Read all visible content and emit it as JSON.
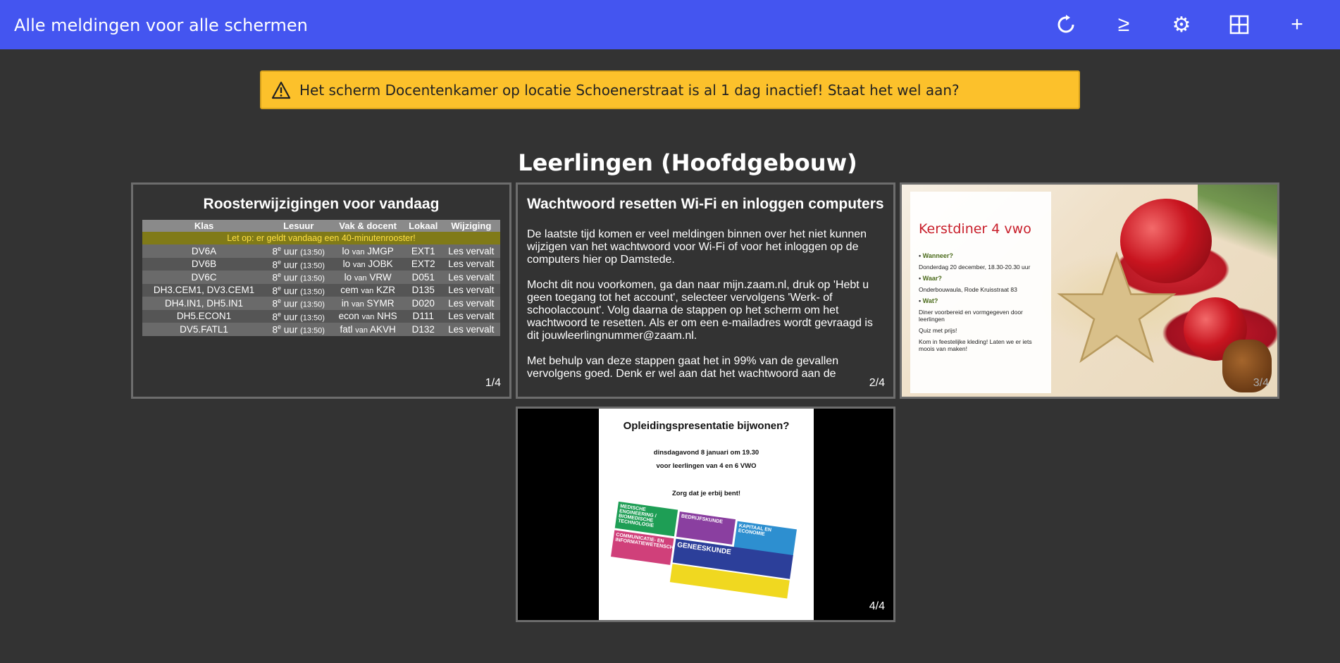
{
  "header": {
    "title": "Alle meldingen voor alle schermen",
    "icons": [
      "refresh-icon",
      "greater-equal-icon",
      "settings-icon",
      "grid-icon",
      "add-icon"
    ],
    "refresh_glyph": "↻",
    "ge_glyph": "≥",
    "gear_glyph": "⚙",
    "plus_glyph": "+"
  },
  "alert": {
    "text": "Het scherm Docentenkamer op locatie Schoenerstraat is al 1 dag inactief! Staat het wel aan?",
    "color": "#fcc12b"
  },
  "section": {
    "title": "Leerlingen (Hoofdgebouw)"
  },
  "slides": {
    "s1": {
      "title": "Roosterwijzigingen voor vandaag",
      "columns": [
        "Klas",
        "Lesuur",
        "Vak & docent",
        "Lokaal",
        "Wijziging"
      ],
      "notice": "Let op: er geldt vandaag een 40-minutenrooster!",
      "rows": [
        {
          "klas": "DV6A",
          "uur": "8",
          "sup": "e",
          "uurword": "uur",
          "tijd": "(13:50)",
          "vak": "lo",
          "van": "van",
          "docent": "JMGP",
          "lokaal": "EXT1",
          "wijziging": "Les vervalt"
        },
        {
          "klas": "DV6B",
          "uur": "8",
          "sup": "e",
          "uurword": "uur",
          "tijd": "(13:50)",
          "vak": "lo",
          "van": "van",
          "docent": "JOBK",
          "lokaal": "EXT2",
          "wijziging": "Les vervalt"
        },
        {
          "klas": "DV6C",
          "uur": "8",
          "sup": "e",
          "uurword": "uur",
          "tijd": "(13:50)",
          "vak": "lo",
          "van": "van",
          "docent": "VRW",
          "lokaal": "D051",
          "wijziging": "Les vervalt"
        },
        {
          "klas": "DH3.CEM1, DV3.CEM1",
          "uur": "8",
          "sup": "e",
          "uurword": "uur",
          "tijd": "(13:50)",
          "vak": "cem",
          "van": "van",
          "docent": "KZR",
          "lokaal": "D135",
          "wijziging": "Les vervalt"
        },
        {
          "klas": "DH4.IN1, DH5.IN1",
          "uur": "8",
          "sup": "e",
          "uurword": "uur",
          "tijd": "(13:50)",
          "vak": "in",
          "van": "van",
          "docent": "SYMR",
          "lokaal": "D020",
          "wijziging": "Les vervalt"
        },
        {
          "klas": "DH5.ECON1",
          "uur": "8",
          "sup": "e",
          "uurword": "uur",
          "tijd": "(13:50)",
          "vak": "econ",
          "van": "van",
          "docent": "NHS",
          "lokaal": "D111",
          "wijziging": "Les vervalt"
        },
        {
          "klas": "DV5.FATL1",
          "uur": "8",
          "sup": "e",
          "uurword": "uur",
          "tijd": "(13:50)",
          "vak": "fatl",
          "van": "van",
          "docent": "AKVH",
          "lokaal": "D132",
          "wijziging": "Les vervalt"
        }
      ],
      "page": "1/4"
    },
    "s2": {
      "title": "Wachtwoord resetten Wi-Fi en inloggen computers",
      "p1": "De laatste tijd komen er veel meldingen binnen over het niet kunnen wijzigen van het wachtwoord voor Wi-Fi of voor het inloggen op de computers hier op Damstede.",
      "p2": "Mocht dit nou voorkomen, ga dan naar mijn.zaam.nl, druk op 'Hebt u geen toegang tot het account', selecteer vervolgens 'Werk- of schoolaccount'. Volg daarna de stappen op het scherm om het wachtwoord te resetten. Als er om een e-mailadres wordt gevraagd is dit jouwleerlingnummer@zaam.nl.",
      "p3": "Met behulp van deze stappen gaat het in 99% van de gevallen vervolgens goed. Denk er wel aan dat het wachtwoord aan de",
      "page": "2/4"
    },
    "s3": {
      "title": "Kerstdiner 4 vwo",
      "q1": "Wanneer?",
      "a1": "Donderdag 20 december, 18.30-20.30 uur",
      "q2": "Waar?",
      "a2": "Onderbouwaula, Rode Kruisstraat 83",
      "q3": "Wat?",
      "a3a": "Diner voorbereid en vormgegeven door leerlingen",
      "a3b": "Quiz met prijs!",
      "a3c": "Kom in feestelijke kleding! Laten we er iets moois van maken!",
      "page": "3/4"
    },
    "s4": {
      "title": "Opleidingspresentatie bijwonen?",
      "line1": "dinsdagavond 8 januari om 19.30",
      "line2": "voor leerlingen van 4 en 6 VWO",
      "line3": "Zorg dat je erbij bent!",
      "tiles": [
        "MEDISCHE ENGINEERING / BIOMEDISCHE TECHNOLOGIE",
        "BEDRIJFSKUNDE",
        "KAPITAAL EN ECONOMIE",
        "COMMUNICATIE- EN INFORMATIEWETENSCHAPPEN",
        "GENEESKUNDE"
      ],
      "page": "4/4"
    }
  }
}
